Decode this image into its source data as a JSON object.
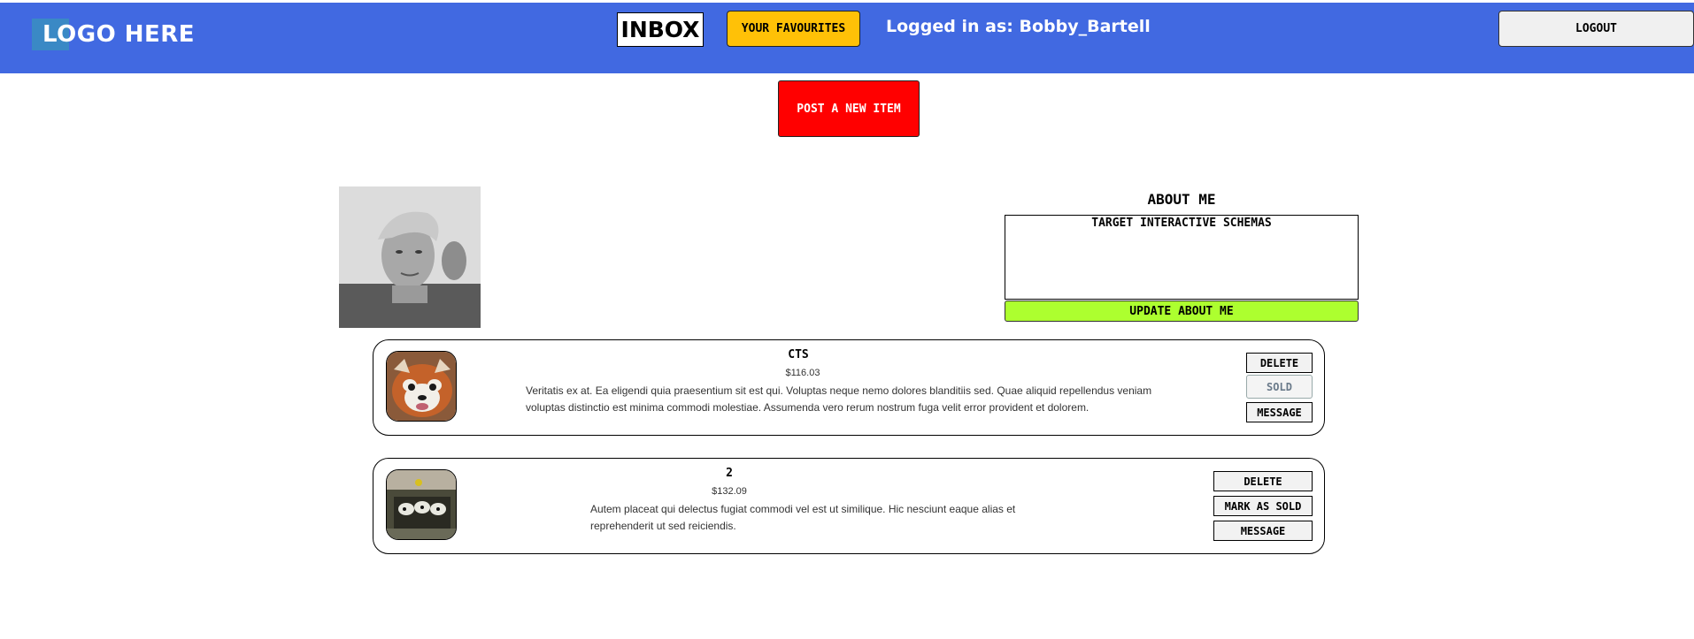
{
  "header": {
    "logo_text": "LOGO HERE",
    "inbox_label": "INBOX",
    "favourites_label": "YOUR FAVOURITES",
    "logged_in_text": "Logged in as: Bobby_Bartell",
    "logout_label": "LOGOUT",
    "accent_color": "#4169e1"
  },
  "post_item": {
    "label": "POST A NEW ITEM",
    "color": "#ff0000"
  },
  "profile": {
    "about_title": "ABOUT ME",
    "about_text": "TARGET INTERACTIVE SCHEMAS",
    "update_label": "UPDATE ABOUT ME",
    "update_color": "#adff2f"
  },
  "items": [
    {
      "title": "CTS",
      "price": "$116.03",
      "description_line1": "Veritatis ex at. Ea eligendi quia praesentium sit est qui. Voluptas neque nemo dolores blanditiis sed. Quae aliquid repellendus veniam",
      "description_line2": "voluptas distinctio est minima commodi molestiae. Assumenda vero rerum nostrum fuga velit error provident et dolorem.",
      "delete_label": "DELETE",
      "sold_label": "SOLD",
      "message_label": "MESSAGE"
    },
    {
      "title": "2",
      "price": "$132.09",
      "description_line1": "Autem placeat qui delectus fugiat commodi vel est ut similique. Hic nesciunt eaque alias et",
      "description_line2": "reprehenderit ut sed reiciendis.",
      "delete_label": "DELETE",
      "sold_label": "MARK AS SOLD",
      "message_label": "MESSAGE"
    }
  ]
}
